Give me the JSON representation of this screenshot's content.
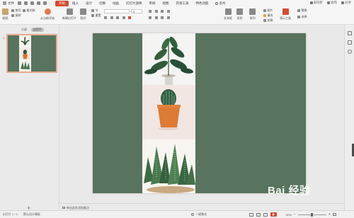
{
  "menu": {
    "file_label": "文件",
    "undo_label": "",
    "redo_label": ""
  },
  "tabs": [
    {
      "label": "开始",
      "active": true
    },
    {
      "label": "插入",
      "active": false
    },
    {
      "label": "设计",
      "active": false
    },
    {
      "label": "切换",
      "active": false
    },
    {
      "label": "动画",
      "active": false
    },
    {
      "label": "幻灯片放映",
      "active": false
    },
    {
      "label": "审阅",
      "active": false
    },
    {
      "label": "视图",
      "active": false
    },
    {
      "label": "开发工具",
      "active": false
    },
    {
      "label": "特色功能",
      "active": false
    }
  ],
  "search_label": "查找",
  "topright": {
    "unsynced": "未同步",
    "collab": "协作",
    "share": "分享"
  },
  "ribbon": {
    "paste": "粘贴",
    "cut": "剪切",
    "copy": "复制",
    "format_painter": "格式刷",
    "from_current": "从当前开始",
    "new_slide": "新建幻灯片",
    "layout": "版式",
    "section": "节",
    "reset": "重置",
    "font_size": "0",
    "textbox": "文本框",
    "shape": "形状",
    "arrange": "排列",
    "replace": "替换",
    "select": "选择",
    "presenter": "演示工具",
    "picture": "图片",
    "fill": "填充",
    "outline": "轮廓"
  },
  "thumbs": {
    "tab_outline": "大纲",
    "tab_slides": "幻灯片",
    "slide_number": "1",
    "add_label": "+"
  },
  "notes_placeholder": "单击此处添加备注",
  "status": {
    "slide_counter": "幻灯片 1 / 1",
    "theme": "默认设计模板",
    "beautify": "一键美化",
    "zoom": "90%"
  },
  "watermark": "Bai 经验",
  "colors": {
    "accent": "#d44a2f",
    "slide_bg": "#58735e"
  },
  "icons": [
    "paste-icon",
    "search-icon",
    "play-icon",
    "plant-icon",
    "cactus-icon"
  ]
}
